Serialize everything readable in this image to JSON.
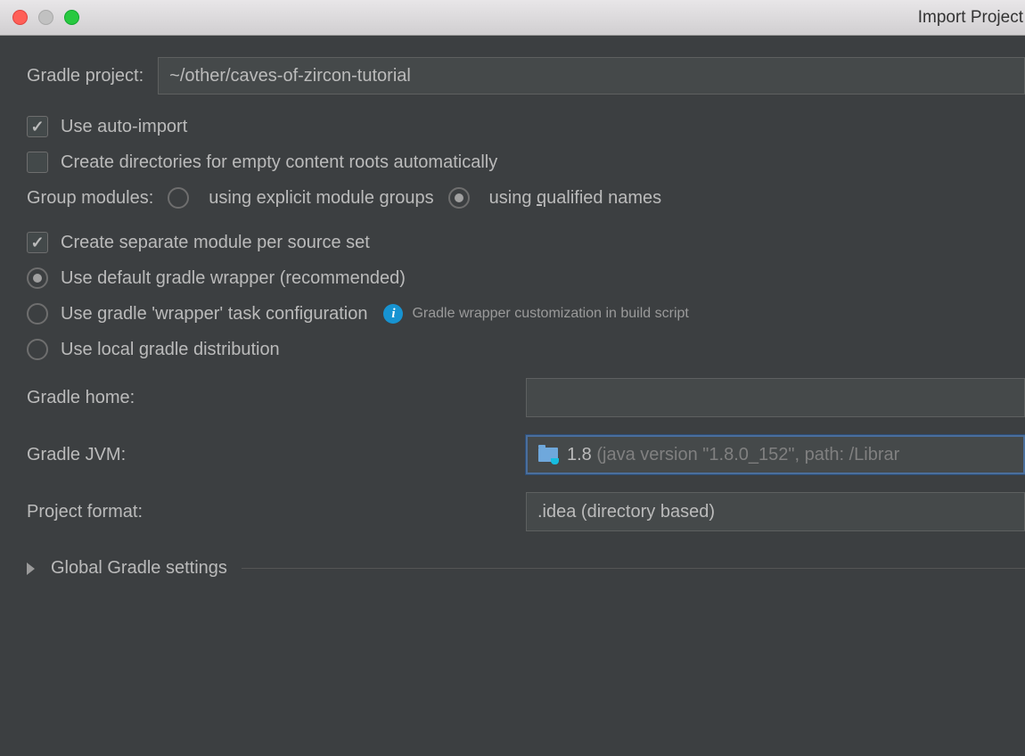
{
  "window": {
    "title": "Import Project"
  },
  "fields": {
    "gradle_project_label": "Gradle project:",
    "gradle_project_value": "~/other/caves-of-zircon-tutorial",
    "gradle_home_label": "Gradle home:",
    "gradle_home_value": "",
    "gradle_jvm_label": "Gradle JVM:",
    "gradle_jvm_version": "1.8 ",
    "gradle_jvm_detail": "(java version \"1.8.0_152\", path: /Librar",
    "project_format_label": "Project format:",
    "project_format_value": ".idea (directory based)"
  },
  "checks": {
    "auto_import": "Use auto-import",
    "create_dirs": "Create directories for empty content roots automatically",
    "separate_module": "Create separate module per source set"
  },
  "group_modules": {
    "label": "Group modules:",
    "opt_explicit_pre": "using explicit module ",
    "opt_explicit_u": "g",
    "opt_explicit_post": "roups",
    "opt_qualified_pre": "using ",
    "opt_qualified_u": "q",
    "opt_qualified_post": "ualified names"
  },
  "wrapper": {
    "default": "Use default gradle wrapper (recommended)",
    "task": "Use gradle 'wrapper' task configuration",
    "task_hint": "Gradle wrapper customization in build script",
    "local": "Use local gradle distribution"
  },
  "section": {
    "global": "Global Gradle settings"
  }
}
